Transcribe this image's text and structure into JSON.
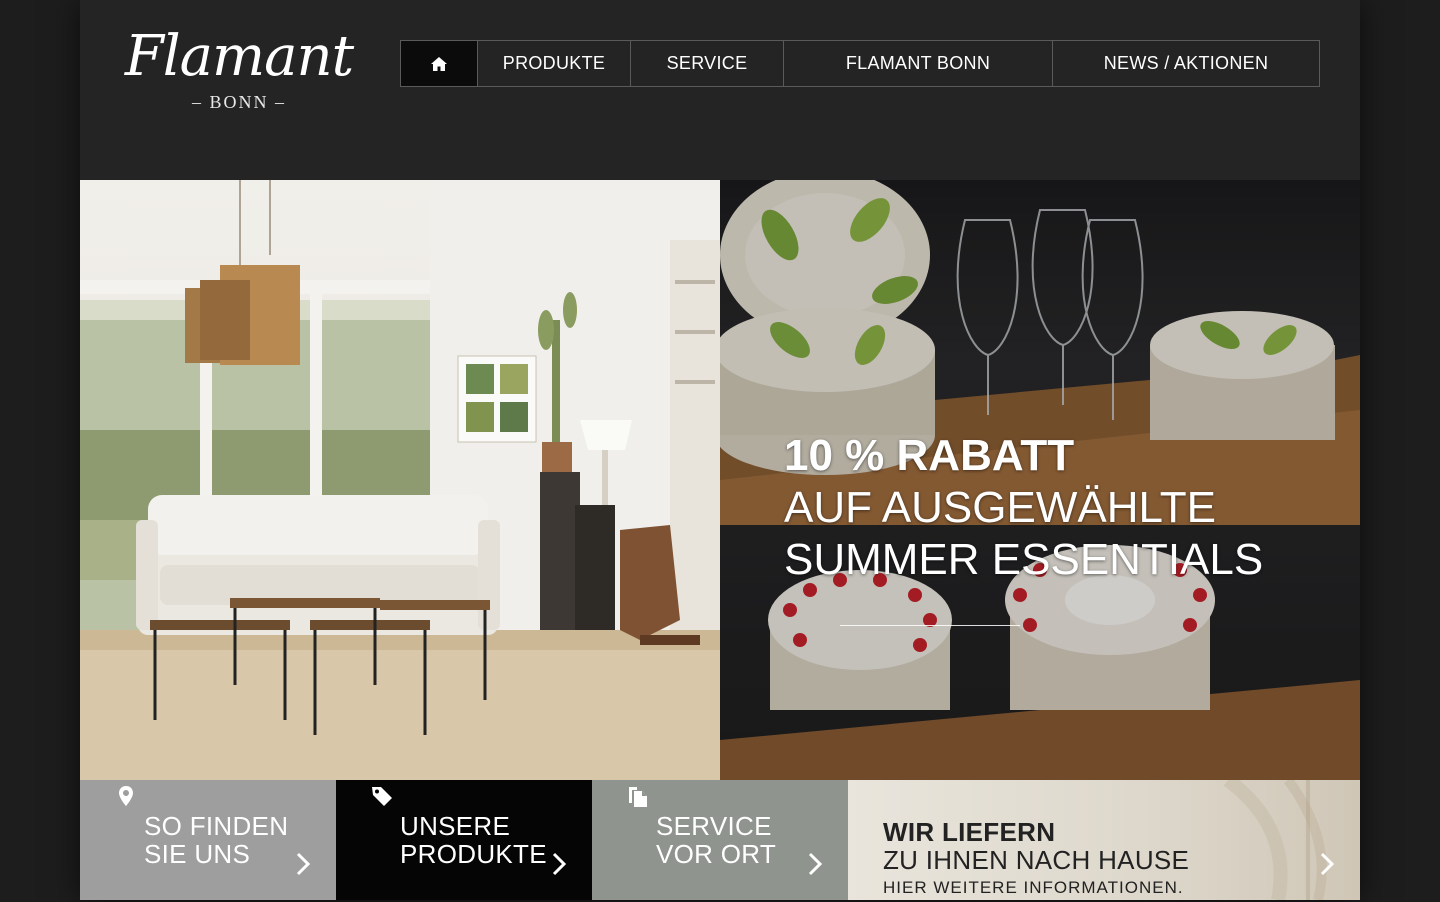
{
  "brand": {
    "logo_text": "Flamant",
    "logo_sub": "– BONN –"
  },
  "nav": {
    "home_icon": "home-icon",
    "items": [
      "PRODUKTE",
      "SERVICE",
      "FLAMANT BONN",
      "NEWS / AKTIONEN"
    ]
  },
  "hero": {
    "line1": "10 % RABATT",
    "line2": "AUF AUSGEWÄHLTE",
    "line3": "SUMMER ESSENTIALS"
  },
  "tiles": [
    {
      "icon": "location-pin-icon",
      "line1": "SO FINDEN",
      "line2": "SIE UNS"
    },
    {
      "icon": "tag-icon",
      "line1": "UNSERE",
      "line2": "PRODUKTE"
    },
    {
      "icon": "documents-icon",
      "line1": "SERVICE",
      "line2": "VOR ORT"
    },
    {
      "line1": "WIR LIEFERN",
      "line2": "ZU IHNEN NACH HAUSE",
      "line3": "HIER WEITERE INFORMATIONEN."
    }
  ],
  "colors": {
    "page_bg": "#242424",
    "tile_gray": "#9e9e9e",
    "tile_black": "#050505",
    "tile_sage": "#8f958e"
  }
}
